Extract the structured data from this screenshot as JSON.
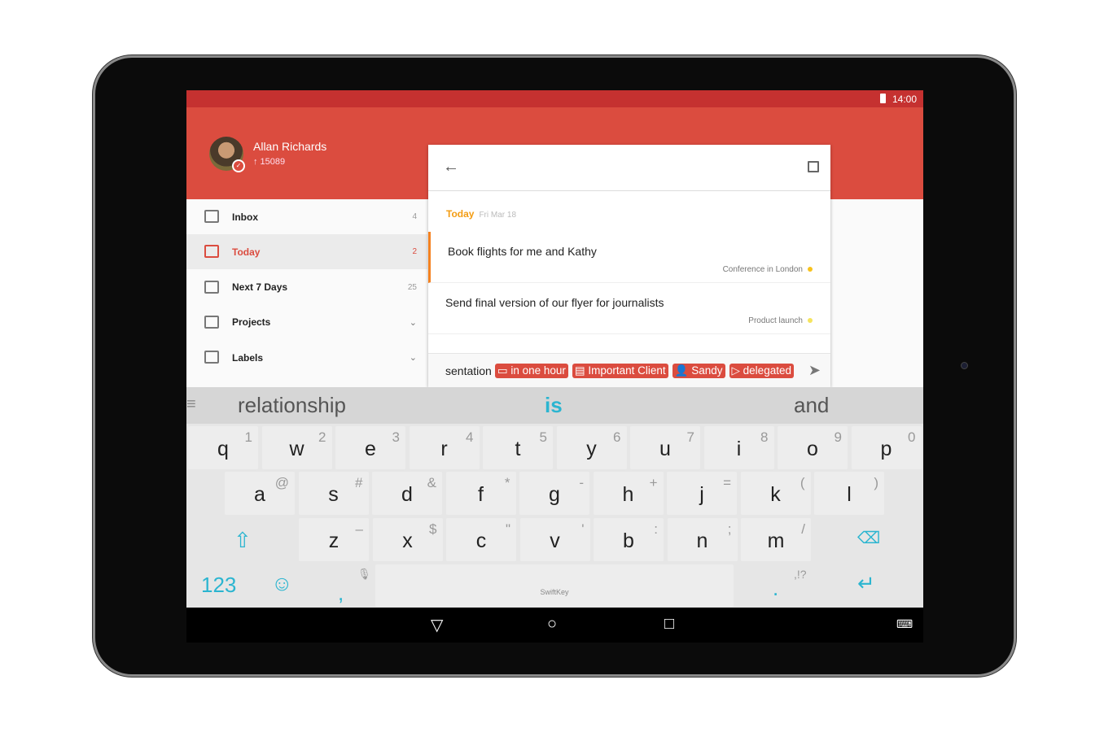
{
  "status": {
    "time": "14:00"
  },
  "user": {
    "name": "Allan Richards",
    "karma": "↑ 15089"
  },
  "sidebar": {
    "items": [
      {
        "label": "Inbox",
        "count": "4",
        "icon": "inbox-icon"
      },
      {
        "label": "Today",
        "count": "2",
        "icon": "calendar-icon",
        "active": true
      },
      {
        "label": "Next 7 Days",
        "count": "25",
        "icon": "calendar-plus7-icon"
      },
      {
        "label": "Projects",
        "count": "",
        "icon": "projects-icon",
        "chevron": "⌄"
      },
      {
        "label": "Labels",
        "count": "",
        "icon": "label-icon",
        "chevron": "⌄"
      }
    ]
  },
  "card": {
    "day": "Today",
    "date": "Fri Mar 18",
    "tasks": [
      {
        "title": "Book flights for me and Kathy",
        "project": "Conference in London",
        "color": "#f8c21c"
      },
      {
        "title": "Send final version of our flyer for journalists",
        "project": "Product launch",
        "color": "#f5e45e"
      }
    ],
    "quick_add": {
      "text": "sentation",
      "chips": [
        "▭ in one hour",
        "▤ Important Client",
        "👤 Sandy",
        "▷ delegated"
      ]
    }
  },
  "keyboard": {
    "suggestions": [
      "relationship",
      "is",
      "and"
    ],
    "rows": [
      [
        [
          "q",
          "1"
        ],
        [
          "w",
          "2"
        ],
        [
          "e",
          "3"
        ],
        [
          "r",
          "4"
        ],
        [
          "t",
          "5"
        ],
        [
          "y",
          "6"
        ],
        [
          "u",
          "7"
        ],
        [
          "i",
          "8"
        ],
        [
          "o",
          "9"
        ],
        [
          "p",
          "0"
        ]
      ],
      [
        [
          "a",
          "@"
        ],
        [
          "s",
          "#"
        ],
        [
          "d",
          "&"
        ],
        [
          "f",
          "*"
        ],
        [
          "g",
          "-"
        ],
        [
          "h",
          "+"
        ],
        [
          "j",
          "="
        ],
        [
          "k",
          "("
        ],
        [
          "l",
          ")"
        ]
      ],
      [
        [
          "z",
          "–"
        ],
        [
          "x",
          "$"
        ],
        [
          "c",
          "\""
        ],
        [
          "v",
          "'"
        ],
        [
          "b",
          ":"
        ],
        [
          "n",
          ";"
        ],
        [
          "m",
          "/"
        ]
      ]
    ],
    "numbers_label": "123",
    "comma": ",",
    "period": ".",
    "punct": ",!?",
    "brand": "SwiftKey",
    "accent": "#2bb5d0"
  },
  "colors": {
    "brand": "#db4c3f",
    "status_bar": "#c53130",
    "accent": "#f39c12"
  }
}
